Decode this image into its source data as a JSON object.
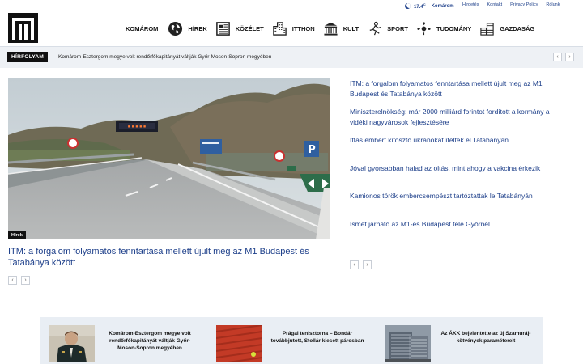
{
  "topbar": {
    "weather": {
      "temp": "17.4",
      "unit": "C",
      "city": "Komárom",
      "icon": "moon-icon"
    },
    "links": [
      "Hirdetés",
      "Kontakt",
      "Privacy Policy",
      "Rólunk"
    ]
  },
  "nav": {
    "items": [
      {
        "label": "KOMÁROM",
        "icon": ""
      },
      {
        "label": "HÍREK",
        "icon": "globe-icon"
      },
      {
        "label": "KÖZÉLET",
        "icon": "newspaper-icon"
      },
      {
        "label": "ITTHON",
        "icon": "buildings-icon"
      },
      {
        "label": "KULT",
        "icon": "temple-icon"
      },
      {
        "label": "SPORT",
        "icon": "runner-icon"
      },
      {
        "label": "TUDOMÁNY",
        "icon": "atom-icon"
      },
      {
        "label": "GAZDASÁG",
        "icon": "coins-icon"
      }
    ]
  },
  "ticker": {
    "label": "HÍRFOLYAM",
    "text": "Komárom-Esztergom megye volt rendőrfőkapitányát váltják Győr-Moson-Sopron megyében"
  },
  "hero": {
    "category": "Hírek",
    "title": "ITM: a forgalom folyamatos fenntartása mellett újult meg az M1 Budapest és Tatabánya között"
  },
  "side_list": [
    "ITM: a forgalom folyamatos fenntartása mellett újult meg az M1 Budapest és Tatabánya között",
    "Miniszterelnökség: már 2000 milliárd forintot fordított a kormány a vidéki nagyvárosok fejlesztésére",
    "Ittas embert kifosztó ukránokat ítéltek el Tatabányán",
    "Jóval gyorsabban halad az oltás, mint ahogy a vakcina érkezik",
    "Kamionos török embercsempészt tartóztattak le Tatabányán",
    "Ismét járható az M1-es Budapest felé Győrnél"
  ],
  "bottom_cards": [
    {
      "title": "Komárom-Esztergom megye volt rendőrfőkapitányát váltják Győr-Moson-Sopron megyében"
    },
    {
      "title": "Prágai tenisztorna – Bondár továbbjutott, Stollár kiesett párosban"
    },
    {
      "title": "Az ÁKK bejelentette az új Szamuráj-kötvények paramétereit"
    }
  ],
  "colors": {
    "link": "#1d3f8a",
    "ticker_bg": "#eef1f5",
    "strip_bg": "#e9eef4"
  }
}
